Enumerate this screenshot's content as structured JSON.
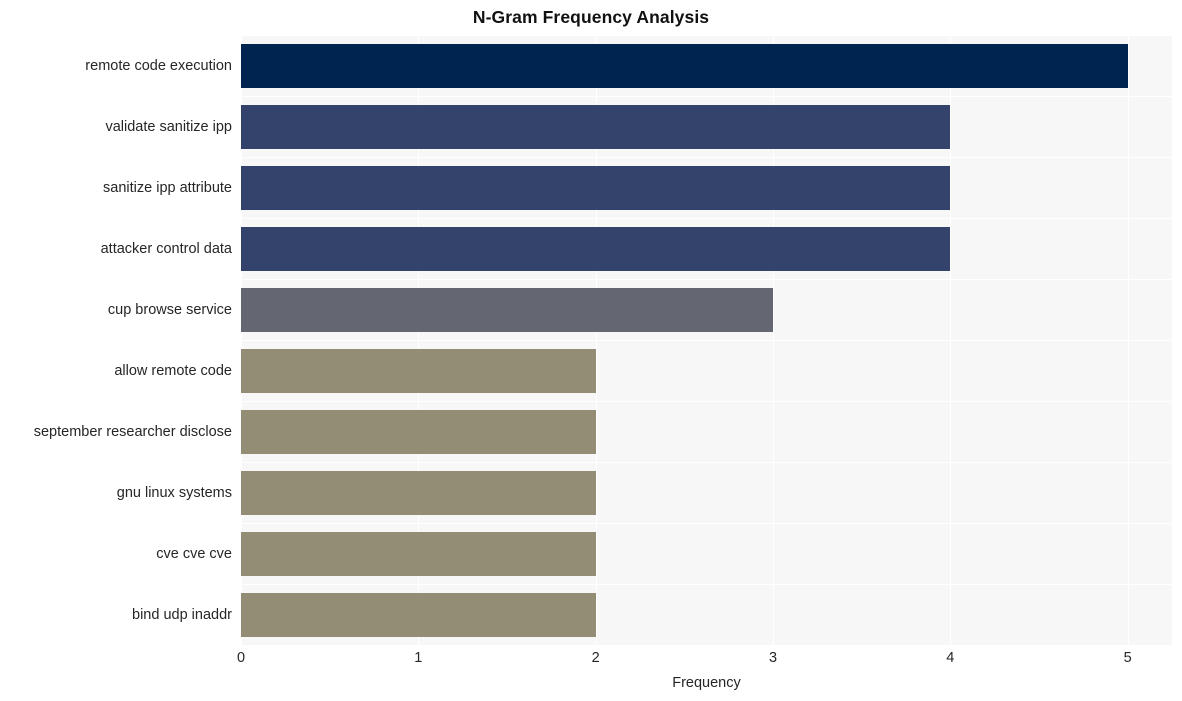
{
  "chart_data": {
    "type": "bar",
    "orientation": "horizontal",
    "title": "N-Gram Frequency Analysis",
    "xlabel": "Frequency",
    "ylabel": "",
    "xlim": [
      0,
      5.25
    ],
    "xticks": [
      "0",
      "1",
      "2",
      "3",
      "4",
      "5"
    ],
    "xtick_values": [
      0,
      1,
      2,
      3,
      4,
      5
    ],
    "grid": true,
    "legend": "none",
    "categories": [
      "remote code execution",
      "validate sanitize ipp",
      "sanitize ipp attribute",
      "attacker control data",
      "cup browse service",
      "allow remote code",
      "september researcher disclose",
      "gnu linux systems",
      "cve cve cve",
      "bind udp inaddr"
    ],
    "values": [
      5,
      4,
      4,
      4,
      3,
      2,
      2,
      2,
      2,
      2
    ],
    "bar_colors": [
      "#002450",
      "#34436b",
      "#34436b",
      "#34436b",
      "#646672",
      "#938d76",
      "#938d76",
      "#938d76",
      "#938d76",
      "#938d76"
    ],
    "plot_background": "#f7f7f7",
    "figure_background": "#ffffff",
    "gridline_color": "#ffffff",
    "text_color": "#262626"
  }
}
